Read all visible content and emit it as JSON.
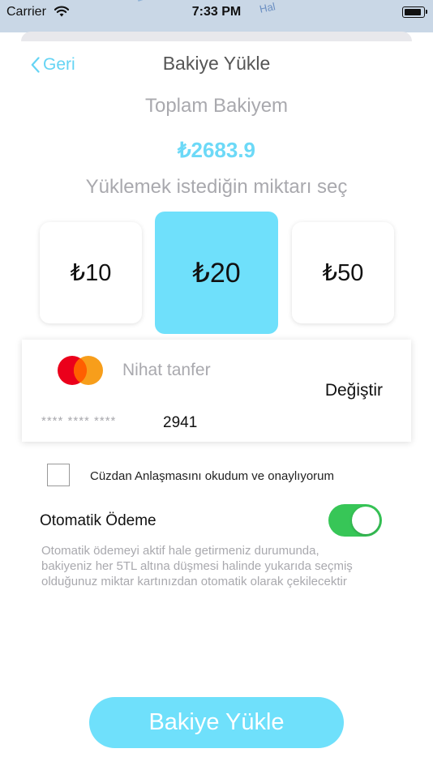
{
  "status_bar": {
    "carrier": "Carrier",
    "time": "7:33 PM",
    "map_text": "Hal"
  },
  "nav": {
    "back_label": "Geri",
    "title": "Bakiye Yükle"
  },
  "balance": {
    "label": "Toplam Bakiyem",
    "value": "₺2683.9"
  },
  "amounts": {
    "label": "Yüklemek istediğin miktarı seç",
    "options": [
      {
        "label": "₺10",
        "selected": false
      },
      {
        "label": "₺20",
        "selected": true
      },
      {
        "label": "₺50",
        "selected": false
      }
    ]
  },
  "card": {
    "brand_icon": "mastercard-icon",
    "holder": "Nihat tanfer",
    "masked": "**** **** ****",
    "last4": "2941",
    "change_label": "Değiştir"
  },
  "agreement": {
    "label": "Cüzdan Anlaşmasını okudum ve onaylıyorum",
    "checked": false
  },
  "auto_payment": {
    "label": "Otomatik Ödeme",
    "enabled": true,
    "description_lines": [
      "Otomatik ödemeyi aktif hale getirmeniz durumunda,",
      "bakiyeniz her 5TL altına düşmesi halinde yukarıda seçmiş",
      "olduğunuz miktar kartınızdan otomatik olarak çekilecektir"
    ]
  },
  "submit": {
    "label": "Bakiye Yükle"
  },
  "colors": {
    "accent": "#6fe0fb",
    "balance": "#6cd9f7",
    "toggle_on": "#37c657",
    "back_link": "#65d4f4"
  }
}
